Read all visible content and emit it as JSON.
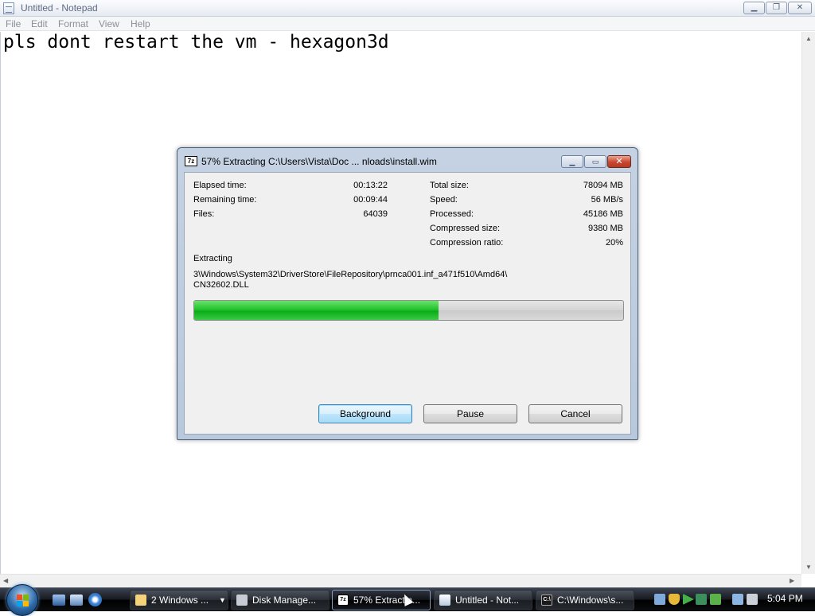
{
  "notepad": {
    "title": "Untitled - Notepad",
    "menu": [
      "File",
      "Edit",
      "Format",
      "View",
      "Help"
    ],
    "content": "pls dont restart the vm - hexagon3d"
  },
  "dialog": {
    "icon_text": "7z",
    "title": "57% Extracting C:\\Users\\Vista\\Doc ... nloads\\install.wim",
    "stats_left": [
      {
        "label": "Elapsed time:",
        "value": "00:13:22"
      },
      {
        "label": "Remaining time:",
        "value": "00:09:44"
      },
      {
        "label": "Files:",
        "value": "64039"
      }
    ],
    "stats_right": [
      {
        "label": "Total size:",
        "value": "78094 MB"
      },
      {
        "label": "Speed:",
        "value": "56 MB/s"
      },
      {
        "label": "Processed:",
        "value": "45186 MB"
      },
      {
        "label": "Compressed size:",
        "value": "9380 MB"
      },
      {
        "label": "Compression ratio:",
        "value": "20%"
      }
    ],
    "extracting_label": "Extracting",
    "current_path_line1": "3\\Windows\\System32\\DriverStore\\FileRepository\\prnca001.inf_a471f510\\Amd64\\",
    "current_path_line2": "CN32602.DLL",
    "progress_fraction": 0.57,
    "buttons": {
      "background": "Background",
      "pause": "Pause",
      "cancel": "Cancel"
    }
  },
  "taskbar": {
    "tasks": [
      {
        "label": "2 Windows ...",
        "icon": "folder-icon"
      },
      {
        "label": "Disk Manage...",
        "icon": "disk-management-icon"
      },
      {
        "label": "57% Extractin...",
        "icon": "7zip-icon"
      },
      {
        "label": "Untitled - Not...",
        "icon": "notepad-icon"
      },
      {
        "label": "C:\\Windows\\s...",
        "icon": "command-prompt-icon"
      }
    ],
    "clock": "5:04 PM"
  },
  "colors": {
    "progress_green": "#1bbd27",
    "vista_taskbar": "#15181e",
    "dialog_frame": "#bccadf"
  }
}
